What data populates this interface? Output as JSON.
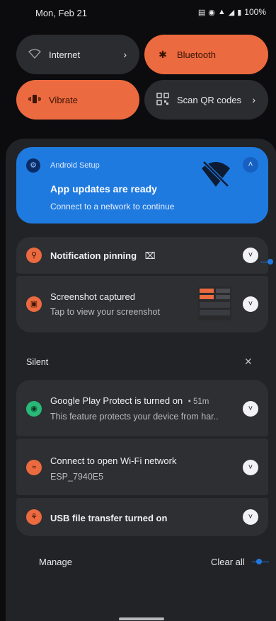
{
  "status_bar": {
    "date": "Mon, Feb 21",
    "battery": "100%"
  },
  "quick_tiles": [
    {
      "label": "Internet",
      "icon": "wifi-icon",
      "active": false
    },
    {
      "label": "Bluetooth",
      "icon": "bluetooth-icon",
      "active": true
    },
    {
      "label": "Vibrate",
      "icon": "vibrate-icon",
      "active": true
    },
    {
      "label": "Scan QR codes",
      "icon": "qr-code-icon",
      "active": false
    }
  ],
  "notifications": {
    "android_setup": {
      "app": "Android Setup",
      "title": "App updates are ready",
      "text": "Connect to a network to continue"
    },
    "pinning": {
      "title": "Notification pinning"
    },
    "screenshot": {
      "title": "Screenshot captured",
      "text": "Tap to view your screenshot"
    }
  },
  "silent_section": {
    "label": "Silent",
    "items": [
      {
        "title": "Google Play Protect is turned on",
        "time": "• 51m",
        "text": "This feature protects your device from har.."
      },
      {
        "title": "Connect to open Wi-Fi network",
        "text": "ESP_7940E5"
      },
      {
        "title": "USB file transfer turned on"
      }
    ]
  },
  "footer": {
    "manage": "Manage",
    "clear_all": "Clear all"
  },
  "colors": {
    "accent_orange": "#ec6a3f",
    "accent_blue": "#1f7ae0",
    "tile_off": "#2b2c30"
  }
}
